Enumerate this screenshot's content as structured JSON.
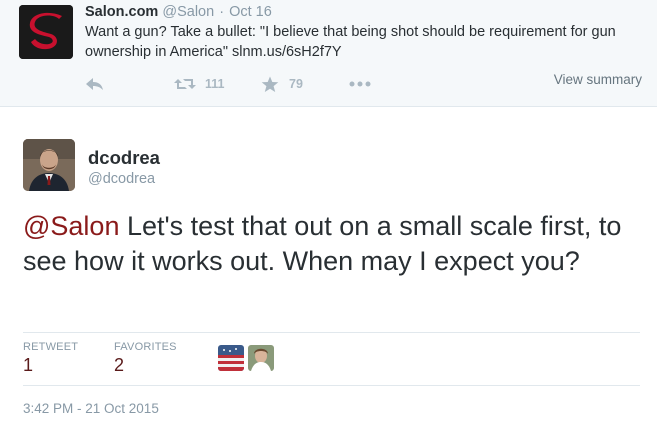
{
  "quoted_tweet": {
    "author_name": "Salon.com",
    "author_handle": "@Salon",
    "separator": "·",
    "date": "Oct 16",
    "text_main": "Want a gun? Take a bullet: \"I believe that being shot should be requirement for gun ownership in America\"",
    "text_link": "slnm.us/6sH2f7Y",
    "retweet_count": "111",
    "favorite_count": "79",
    "view_summary": "View summary",
    "icons": {
      "logo": "salon-s-logo",
      "reply": "reply-icon",
      "retweet": "retweet-icon",
      "favorite": "star-icon",
      "more": "more-icon"
    }
  },
  "tweet": {
    "author_name": "dcodrea",
    "author_handle": "@dcodrea",
    "mention": "@Salon",
    "text": " Let's test that out on a small scale first, to see how it works out. When may I expect you?",
    "stats": {
      "retweet_label": "RETWEET",
      "retweet_value": "1",
      "favorites_label": "FAVORITES",
      "favorites_value": "2"
    },
    "timestamp": "3:42 PM - 21 Oct 2015"
  },
  "colors": {
    "brand_salon": "#c8102e",
    "mention": "#8a1a1a",
    "stat_value": "#5a1a1a",
    "muted": "#8899a6"
  }
}
